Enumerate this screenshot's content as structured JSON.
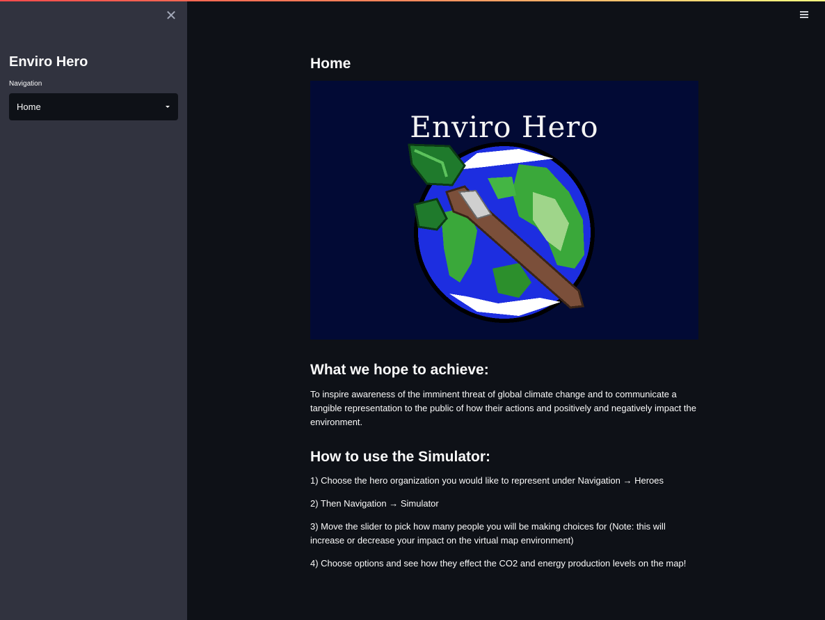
{
  "sidebar": {
    "title": "Enviro Hero",
    "nav_label": "Navigation",
    "nav_selected": "Home"
  },
  "main": {
    "page_title": "Home",
    "banner_title": "Enviro Hero",
    "section1": {
      "heading": "What we hope to achieve:",
      "text": "To inspire awareness of the imminent threat of global climate change and to communicate a tangible representation to the public of how their actions and positively and negatively impact the environment."
    },
    "section2": {
      "heading": "How to use the Simulator:",
      "steps": [
        "1) Choose the hero organization you would like to represent under Navigation → Heroes",
        "2) Then Navigation → Simulator",
        "3) Move the slider to pick how many people you will be making choices for (Note: this will increase or decrease your impact on the virtual map environment)",
        "4) Choose options and see how they effect the CO2 and energy production levels on the map!"
      ]
    }
  },
  "icons": {
    "close": "close-icon",
    "menu": "hamburger-menu-icon",
    "dropdown": "chevron-down-icon"
  }
}
